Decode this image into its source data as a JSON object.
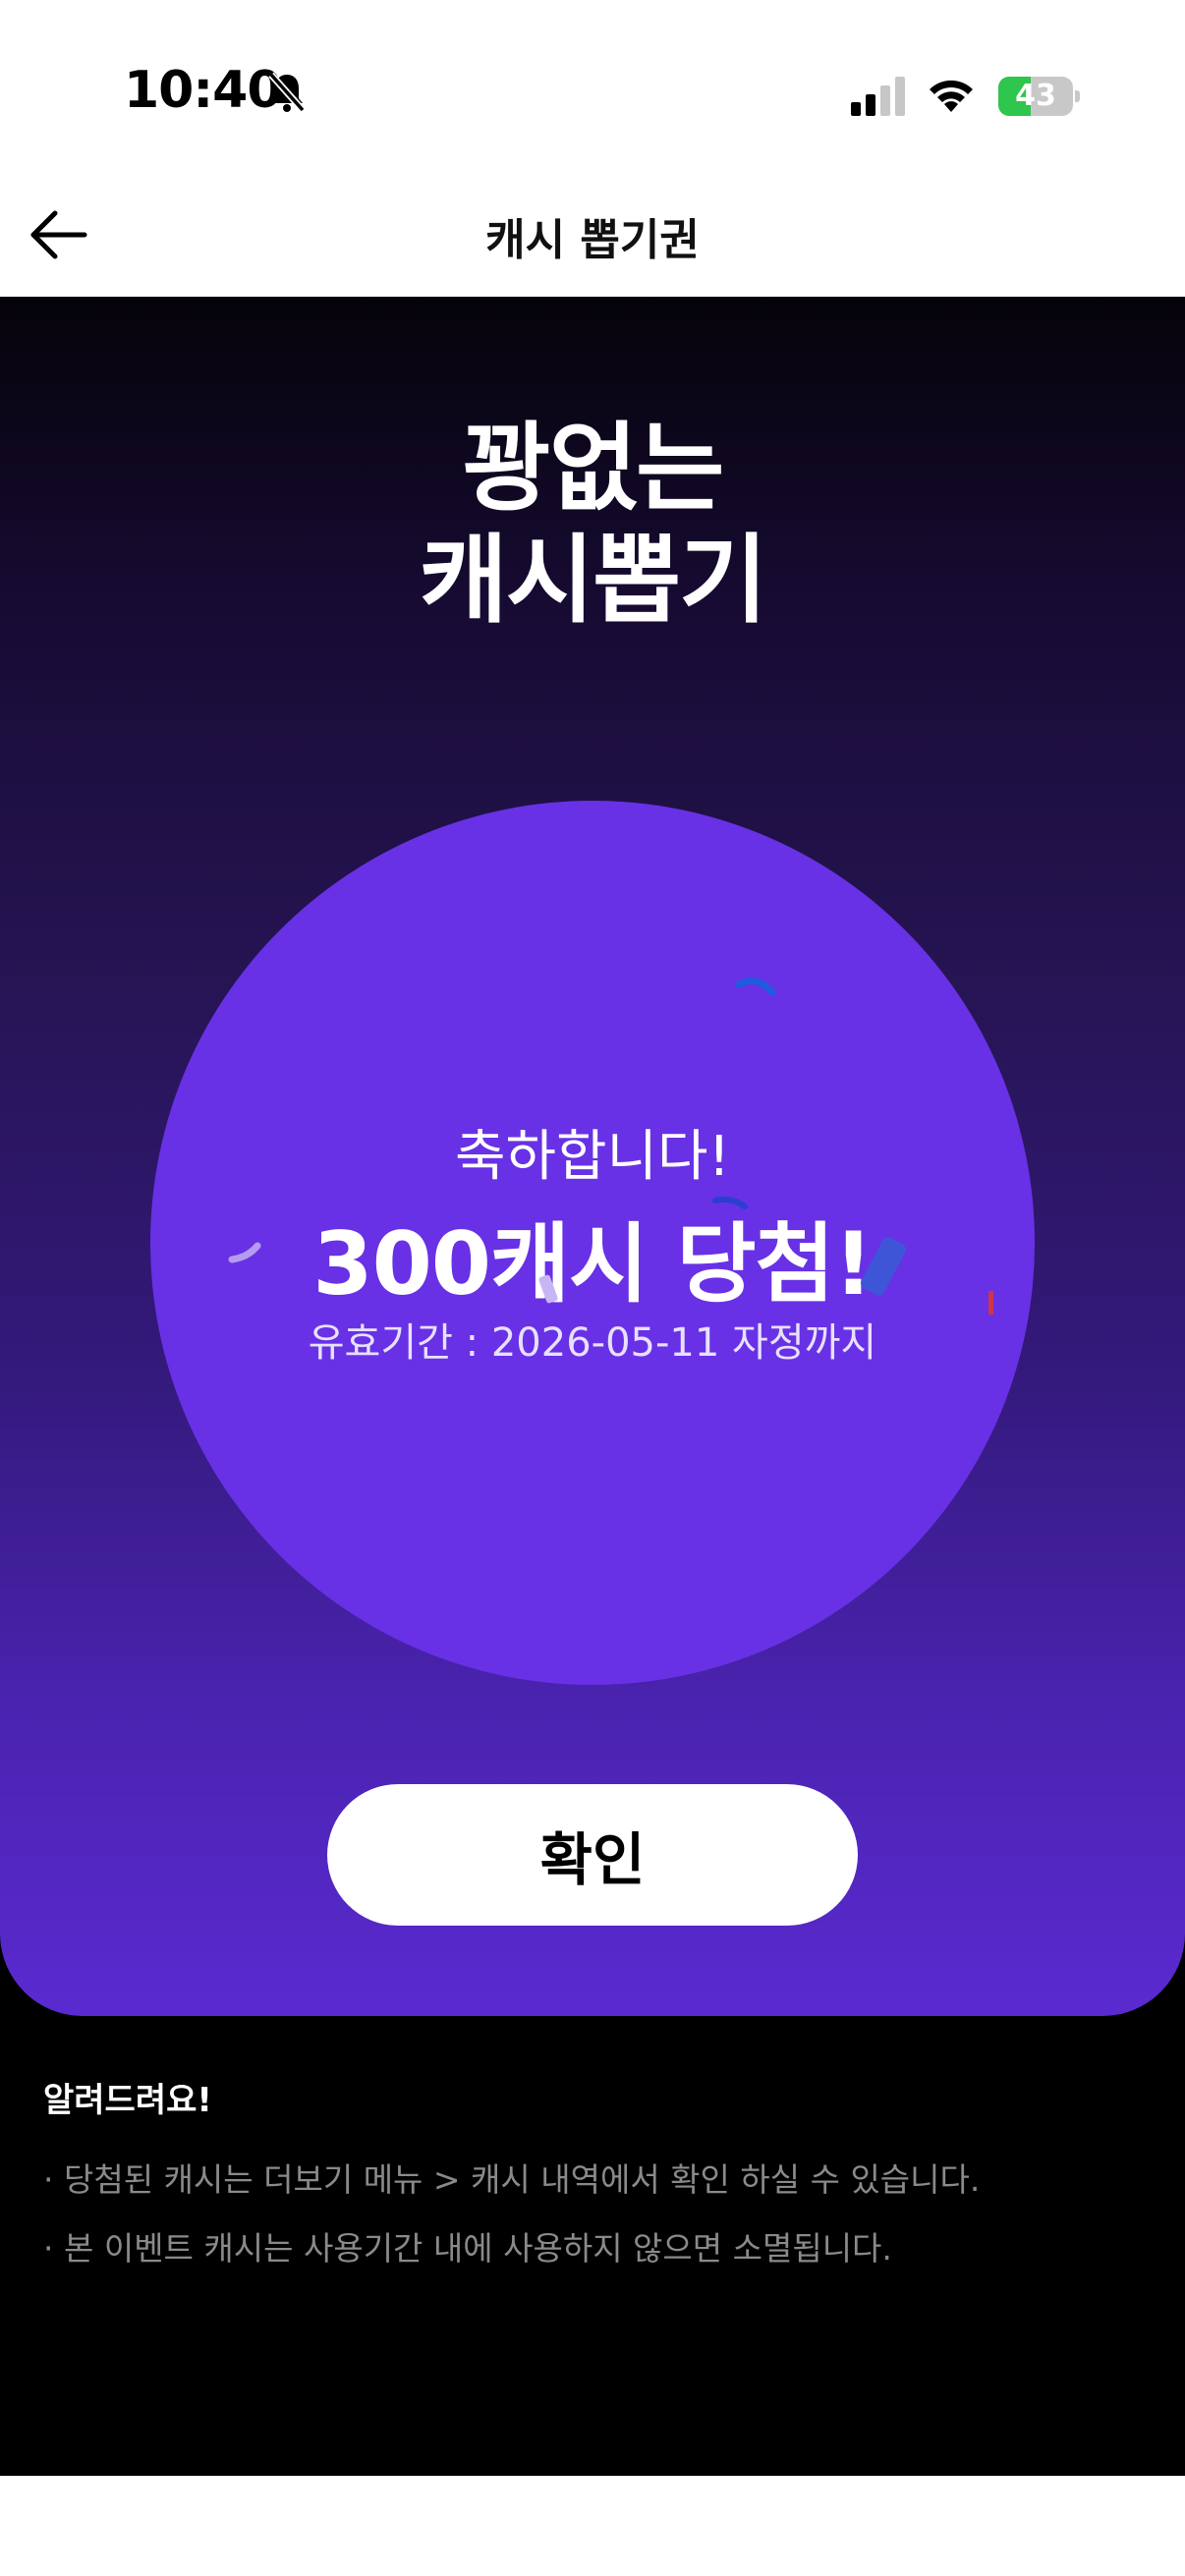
{
  "status_bar": {
    "time": "10:40",
    "battery_percent": "43",
    "battery_level": 0.43,
    "icons": [
      "bell-slash-icon",
      "cellular-signal-icon",
      "wifi-icon",
      "battery-charging-icon"
    ]
  },
  "nav": {
    "title": "캐시 뽑기권",
    "back_icon": "arrow-left-icon"
  },
  "hero": {
    "title_line1": "꽝없는",
    "title_line2": "캐시뽑기",
    "congrats": "축하합니다!",
    "prize": "300캐시 당첨!",
    "expiry": "유효기간 : 2026-05-11 자정까지",
    "confirm_label": "확인"
  },
  "notice": {
    "title": "알려드려요!",
    "items": [
      "· 당첨된 캐시는 더보기 메뉴 > 캐시 내역에서 확인 하실 수 있습니다.",
      "· 본 이벤트 캐시는 사용기간 내에 사용하지 않으면 소멸됩니다."
    ]
  },
  "colors": {
    "circle": "#6831e5",
    "hero_bottom": "#5a2ad0",
    "battery_green": "#30c54c"
  }
}
